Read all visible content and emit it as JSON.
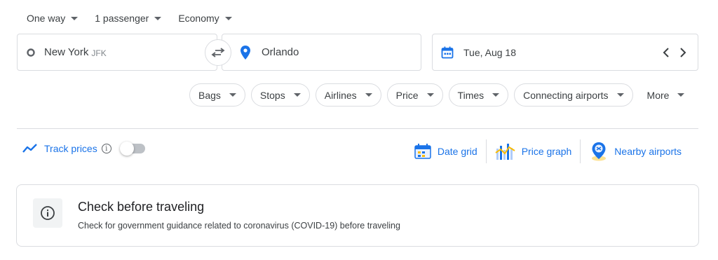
{
  "trip_options": {
    "trip_type": "One way",
    "passengers": "1 passenger",
    "cabin_class": "Economy"
  },
  "search": {
    "origin_city": "New York",
    "origin_code": "JFK",
    "destination_city": "Orlando",
    "departure_date": "Tue, Aug 18"
  },
  "filters": [
    "Bags",
    "Stops",
    "Airlines",
    "Price",
    "Times",
    "Connecting airports",
    "More"
  ],
  "track_prices": {
    "label": "Track prices",
    "info_glyph": "i",
    "enabled": false
  },
  "tools": {
    "date_grid": "Date grid",
    "price_graph": "Price graph",
    "nearby_airports": "Nearby airports"
  },
  "notice": {
    "title": "Check before traveling",
    "text": "Check for government guidance related to coronavirus (COVID-19) before traveling"
  },
  "colors": {
    "accent": "#1a73e8",
    "border": "#dadce0",
    "text": "#3c4043"
  }
}
